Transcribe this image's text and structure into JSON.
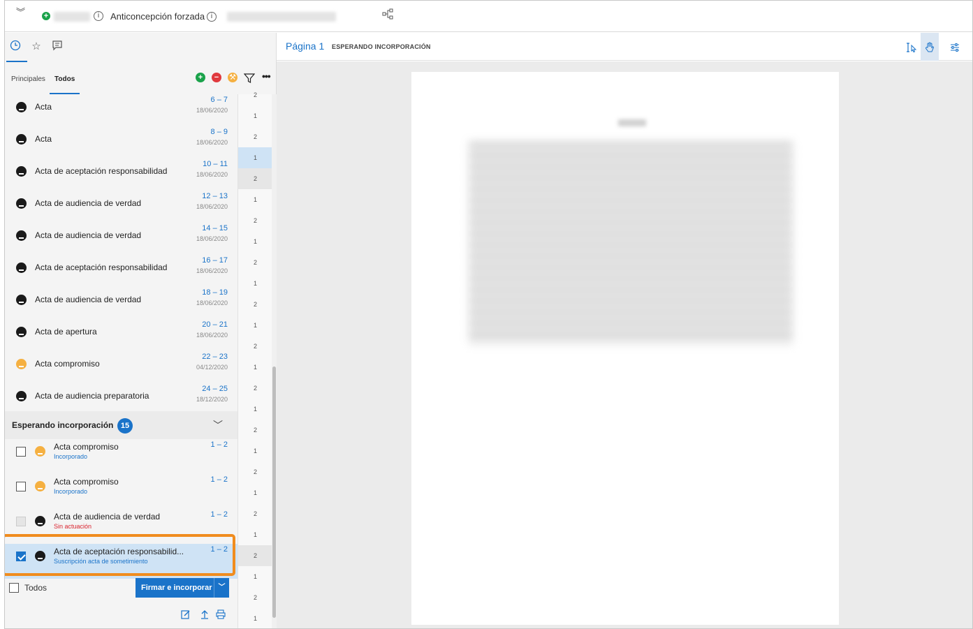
{
  "header": {
    "case_title": "Anticoncepción forzada",
    "info_glyph": "i"
  },
  "left_tabs": {
    "icons": [
      "clock-icon",
      "star-icon",
      "comment-icon"
    ],
    "sub_tabs": [
      "Principales",
      "Todos"
    ],
    "active_sub_tab": "Todos"
  },
  "documents": [
    {
      "label": "Acta",
      "pages": "6 – 7",
      "date": "18/06/2020",
      "icon": "stamp-icon"
    },
    {
      "label": "Acta",
      "pages": "8 – 9",
      "date": "18/06/2020",
      "icon": "stamp-icon"
    },
    {
      "label": "Acta de aceptación responsabilidad",
      "pages": "10 – 11",
      "date": "18/06/2020",
      "icon": "stamp-icon"
    },
    {
      "label": "Acta de audiencia de verdad",
      "pages": "12 – 13",
      "date": "18/06/2020",
      "icon": "stamp-icon"
    },
    {
      "label": "Acta de audiencia de verdad",
      "pages": "14 – 15",
      "date": "18/06/2020",
      "icon": "stamp-icon"
    },
    {
      "label": "Acta de aceptación responsabilidad",
      "pages": "16 – 17",
      "date": "18/06/2020",
      "icon": "stamp-icon"
    },
    {
      "label": "Acta de audiencia de verdad",
      "pages": "18 – 19",
      "date": "18/06/2020",
      "icon": "stamp-icon"
    },
    {
      "label": "Acta de apertura",
      "pages": "20 – 21",
      "date": "18/06/2020",
      "icon": "document-icon"
    },
    {
      "label": "Acta compromiso",
      "pages": "22 – 23",
      "date": "04/12/2020",
      "icon": "gavel-icon"
    },
    {
      "label": "Acta de audiencia preparatoria",
      "pages": "24 – 25",
      "date": "18/12/2020",
      "icon": "stamp-icon"
    }
  ],
  "waiting": {
    "title": "Esperando incorporación",
    "count": "15",
    "items": [
      {
        "label": "Acta compromiso",
        "status": "Incorporado",
        "pages": "1 – 2",
        "icon": "gavel-icon",
        "checked": false,
        "disabled": false,
        "status_color": "#1a73c9"
      },
      {
        "label": "Acta compromiso",
        "status": "Incorporado",
        "pages": "1 – 2",
        "icon": "gavel-icon",
        "checked": false,
        "disabled": false,
        "status_color": "#1a73c9"
      },
      {
        "label": "Acta de audiencia de verdad",
        "status": "Sin actuación",
        "pages": "1 – 2",
        "icon": "stamp-icon",
        "checked": false,
        "disabled": true,
        "status_color": "#d9232e"
      },
      {
        "label": "Acta de aceptación responsabilid...",
        "status": "Suscripción acta de sometimiento",
        "pages": "1 – 2",
        "icon": "stamp-icon",
        "checked": true,
        "disabled": false,
        "status_color": "#1a73c9"
      }
    ]
  },
  "footer": {
    "select_all_label": "Todos",
    "sign_button_label": "Firmar e incorporar",
    "icons": [
      "edit-icon",
      "upload-icon",
      "print-icon"
    ]
  },
  "page_column": [
    "2",
    "1",
    "2",
    "1",
    "2",
    "1",
    "2",
    "1",
    "2",
    "1",
    "2",
    "1",
    "2",
    "1",
    "2",
    "1",
    "2",
    "1",
    "2",
    "1",
    "2",
    "1",
    "2",
    "1",
    "2",
    "1"
  ],
  "viewer": {
    "page_label": "Página 1",
    "state_label": "ESPERANDO INCORPORACIÓN",
    "tools": [
      "text-select-icon",
      "hand-icon",
      "settings-sliders-icon"
    ]
  },
  "colors": {
    "accent": "#1a73c9",
    "highlight_border": "#f08c1e",
    "add_green": "#1aa24a",
    "remove_red": "#e0393e",
    "gavel_orange": "#f5b041"
  }
}
